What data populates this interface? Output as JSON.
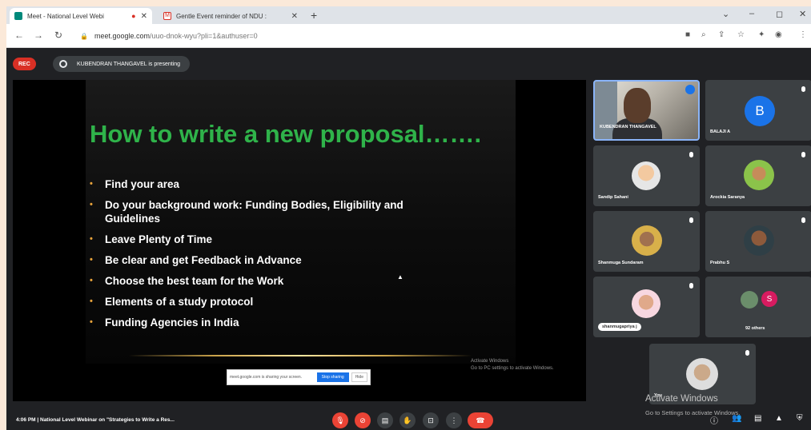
{
  "browser": {
    "tabs": [
      {
        "title": "Meet - National Level Webi",
        "active": true
      },
      {
        "title": "Gentle Event reminder of NDU :",
        "active": false
      }
    ],
    "new_tab": "+",
    "url_host": "meet.google.com",
    "url_path": "/uuo-dnok-wyu?pli=1&authuser=0",
    "win_minimize": "–",
    "win_restore": "◻",
    "win_close": "✕"
  },
  "meet": {
    "rec_label": "REC",
    "presenter_banner": "KUBENDRAN THANGAVEL is presenting",
    "slide": {
      "title": "How to write a new proposal…….",
      "bullets": [
        "Find your area",
        "Do your background work: Funding Bodies, Eligibility and Guidelines",
        "Leave Plenty of Time",
        "Be clear and get Feedback in Advance",
        "Choose the best team for the Work",
        "Elements of a study protocol",
        "Funding Agencies in India"
      ],
      "share_text": "meet.google.com is sharing your screen.",
      "stop_sharing": "Stop sharing",
      "hide": "Hide",
      "activate_line1": "Activate Windows",
      "activate_line2": "Go to PC settings to activate Windows."
    },
    "participants": [
      {
        "name": "KUBENDRAN THANGAVEL"
      },
      {
        "name": "BALAJI A",
        "initial": "B"
      },
      {
        "name": "Sandip Sahani"
      },
      {
        "name": "Arockia Saranya"
      },
      {
        "name": "Shanmuga Sundaram"
      },
      {
        "name": "Prabhu S"
      },
      {
        "name": "shanmugapriya j"
      },
      {
        "name": "92 others",
        "initial": "S"
      },
      {
        "name": "You"
      }
    ],
    "meeting_info": "4:06 PM  |  National Level Webinar on \"Strategies to Write a Res...",
    "activate_windows": "Activate Windows",
    "activate_windows_sub": "Go to Settings to activate Windows."
  },
  "colors": {
    "accent": "#1a73e8",
    "slide_title": "#2fb34a",
    "rec": "#d93025",
    "end_call": "#ea4335"
  }
}
